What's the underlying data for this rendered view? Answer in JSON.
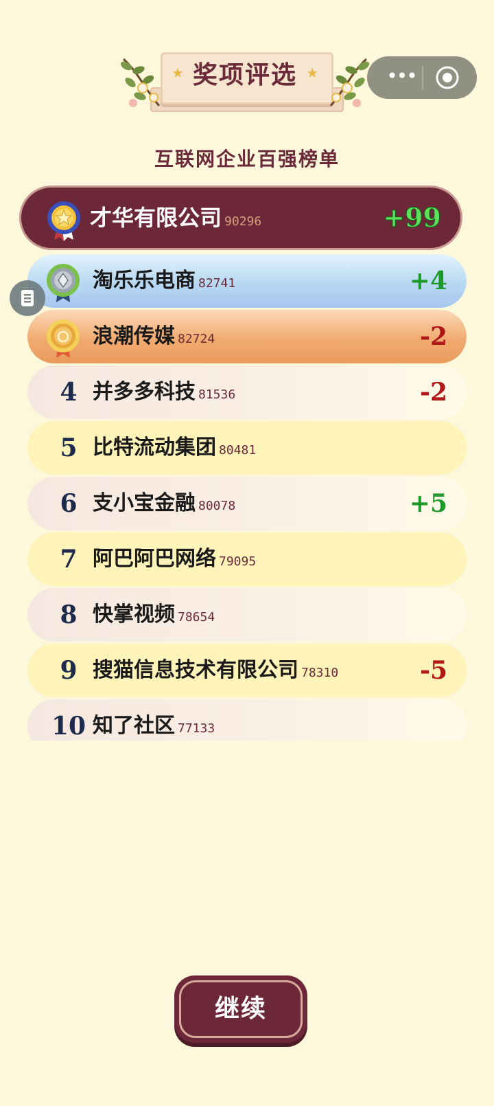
{
  "header": {
    "title": "奖项评选",
    "subtitle": "互联网企业百强榜单"
  },
  "rankings": [
    {
      "rank": "1",
      "name": "才华有限公司",
      "score": "90296",
      "change": "+99",
      "medal": "gold-star-medal"
    },
    {
      "rank": "2",
      "name": "淘乐乐电商",
      "score": "82741",
      "change": "+4",
      "medal": "silver-medal"
    },
    {
      "rank": "3",
      "name": "浪潮传媒",
      "score": "82724",
      "change": "-2",
      "medal": "bronze-medal"
    },
    {
      "rank": "4",
      "name": "并多多科技",
      "score": "81536",
      "change": "-2"
    },
    {
      "rank": "5",
      "name": "比特流动集团",
      "score": "80481",
      "change": ""
    },
    {
      "rank": "6",
      "name": "支小宝金融",
      "score": "80078",
      "change": "+5"
    },
    {
      "rank": "7",
      "name": "阿巴阿巴网络",
      "score": "79095",
      "change": ""
    },
    {
      "rank": "8",
      "name": "快掌视频",
      "score": "78654",
      "change": ""
    },
    {
      "rank": "9",
      "name": "搜猫信息技术有限公司",
      "score": "78310",
      "change": "-5"
    },
    {
      "rank": "10",
      "name": "知了社区",
      "score": "77133",
      "change": ""
    }
  ],
  "continue_label": "继续",
  "colors": {
    "accent": "#6c2738",
    "background": "#fdf7dc",
    "up": "#1d9a2a",
    "down": "#b01818"
  },
  "icons": {
    "menu": "more-dots-icon",
    "close": "target-icon",
    "side": "document-icon"
  }
}
